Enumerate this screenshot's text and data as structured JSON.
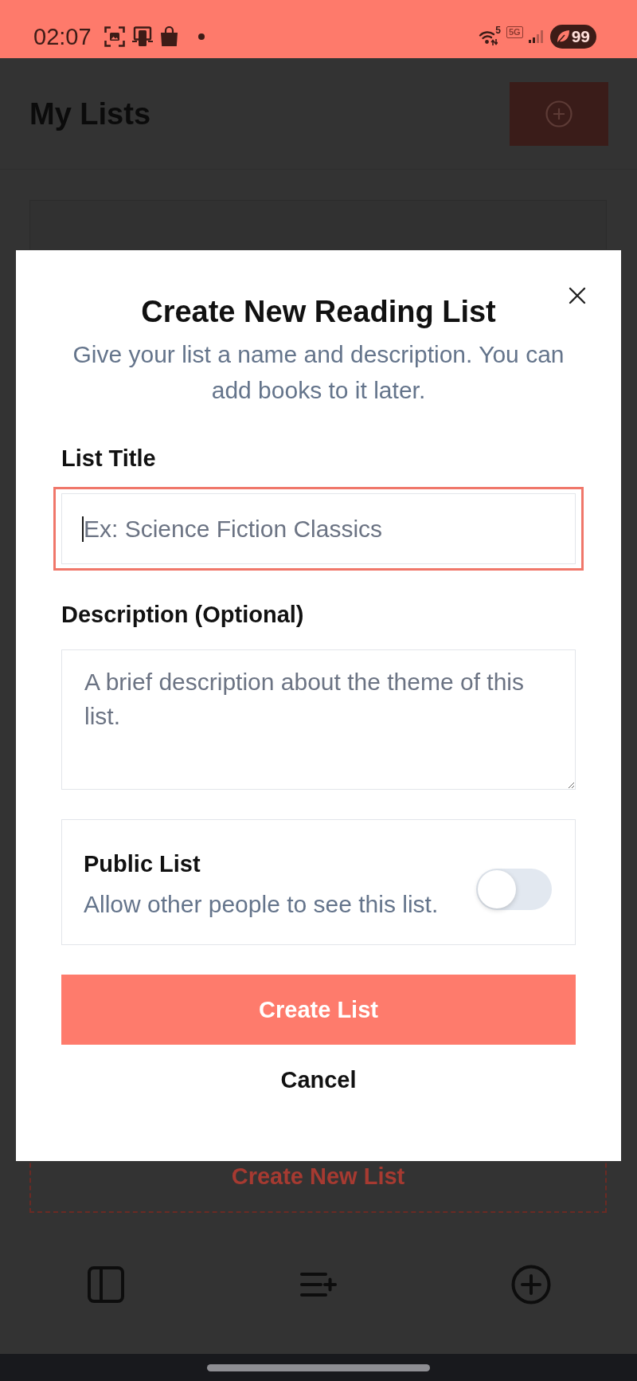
{
  "status_bar": {
    "time": "02:07",
    "wifi_label": "5",
    "network_label": "5G",
    "battery": "99"
  },
  "header": {
    "title": "My Lists"
  },
  "lists": {
    "new_list_label": "Create New List"
  },
  "dialog": {
    "title": "Create New Reading List",
    "subtitle": "Give your list a name and description. You can add books to it later.",
    "fields": [
      {
        "kind": "text",
        "label": "List Title",
        "placeholder": "Ex: Science Fiction Classics",
        "focused": true
      },
      {
        "kind": "textarea",
        "label": "Description (Optional)",
        "placeholder": "A brief description about the theme of this list.",
        "focused": false
      }
    ],
    "public_setting": {
      "label": "Public List",
      "description": "Allow other people to see this list.",
      "on": false
    },
    "buttons": [
      {
        "kind": "primary",
        "label": "Create List"
      },
      {
        "kind": "text",
        "label": "Cancel"
      }
    ]
  }
}
